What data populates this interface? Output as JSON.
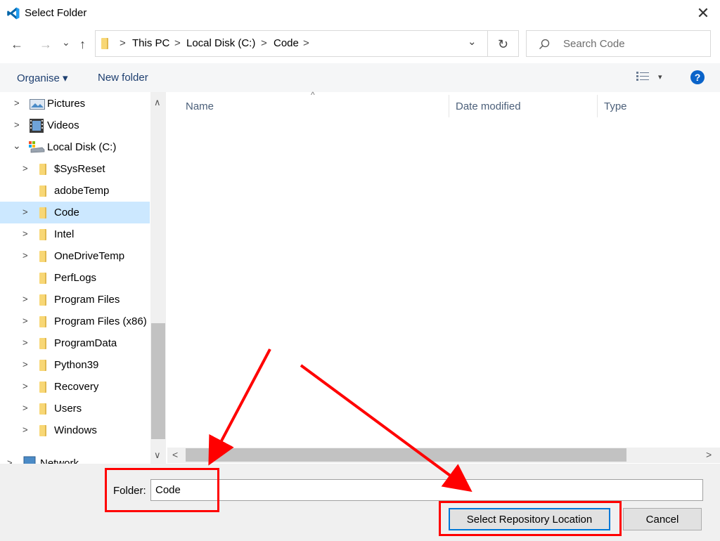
{
  "window": {
    "title": "Select Folder",
    "close_glyph": "✕",
    "app_icon": "vscode-icon"
  },
  "nav_buttons": {
    "back": "←",
    "forward": "→",
    "recent": "⌄",
    "up": "↑"
  },
  "breadcrumb": {
    "items": [
      "This PC",
      "Local Disk (C:)",
      "Code"
    ],
    "separator": ">",
    "dropdown": "⌄",
    "refresh": "↻"
  },
  "search": {
    "placeholder": "Search Code",
    "icon": "search-icon"
  },
  "toolbar": {
    "organise": "Organise ▾",
    "new_folder": "New folder",
    "view_arrow": "▾",
    "help": "?"
  },
  "tree": {
    "items": [
      {
        "label": "Pictures",
        "icon": "pictures-icon",
        "expanded": false
      },
      {
        "label": "Videos",
        "icon": "videos-icon",
        "expanded": false
      },
      {
        "label": "Local Disk (C:)",
        "icon": "drive-icon",
        "expanded": true
      },
      {
        "label": "$SysReset",
        "icon": "folder-icon",
        "expanded": false
      },
      {
        "label": "adobeTemp",
        "icon": "folder-icon"
      },
      {
        "label": "Code",
        "icon": "folder-icon",
        "selected": true
      },
      {
        "label": "Intel",
        "icon": "folder-icon"
      },
      {
        "label": "OneDriveTemp",
        "icon": "folder-icon"
      },
      {
        "label": "PerfLogs",
        "icon": "folder-icon"
      },
      {
        "label": "Program Files",
        "icon": "folder-icon"
      },
      {
        "label": "Program Files (x86)",
        "icon": "folder-icon"
      },
      {
        "label": "ProgramData",
        "icon": "folder-icon"
      },
      {
        "label": "Python39",
        "icon": "folder-icon"
      },
      {
        "label": "Recovery",
        "icon": "folder-icon"
      },
      {
        "label": "Users",
        "icon": "folder-icon"
      },
      {
        "label": "Windows",
        "icon": "folder-icon"
      },
      {
        "label": "Network",
        "icon": "network-icon"
      }
    ]
  },
  "columns": {
    "name": "Name",
    "date_modified": "Date modified",
    "type": "Type",
    "sort_glyph": "^"
  },
  "footer": {
    "folder_label": "Folder:",
    "folder_value": "Code",
    "select_button": "Select Repository Location",
    "cancel_button": "Cancel"
  },
  "colors": {
    "annotation": "#ff0000",
    "accent": "#0078d7",
    "selection": "#cce8ff"
  }
}
